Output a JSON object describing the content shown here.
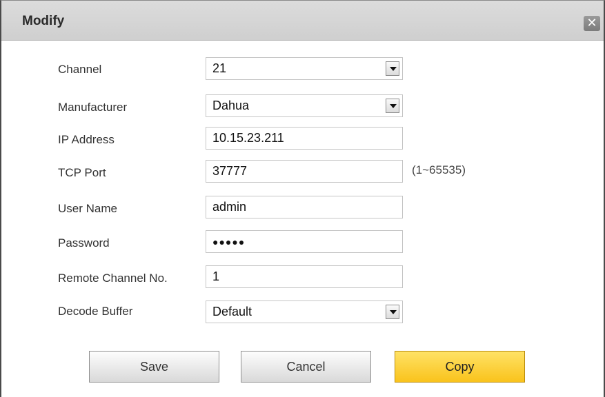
{
  "dialog": {
    "title": "Modify",
    "close_icon": "close-icon"
  },
  "form": {
    "channel": {
      "label": "Channel",
      "value": "21"
    },
    "manufacturer": {
      "label": "Manufacturer",
      "value": "Dahua"
    },
    "ip_address": {
      "label": "IP Address",
      "value": "10.15.23.211"
    },
    "tcp_port": {
      "label": "TCP Port",
      "value": "37777",
      "hint": "(1~65535)"
    },
    "user_name": {
      "label": "User Name",
      "value": "admin"
    },
    "password": {
      "label": "Password",
      "value": "●●●●●"
    },
    "remote_channel": {
      "label": "Remote Channel No.",
      "value": "1"
    },
    "decode_buffer": {
      "label": "Decode Buffer",
      "value": "Default"
    }
  },
  "buttons": {
    "save": "Save",
    "cancel": "Cancel",
    "copy": "Copy"
  },
  "colors": {
    "copy_button": "#f9c31c",
    "titlebar": "#d4d4d4"
  }
}
